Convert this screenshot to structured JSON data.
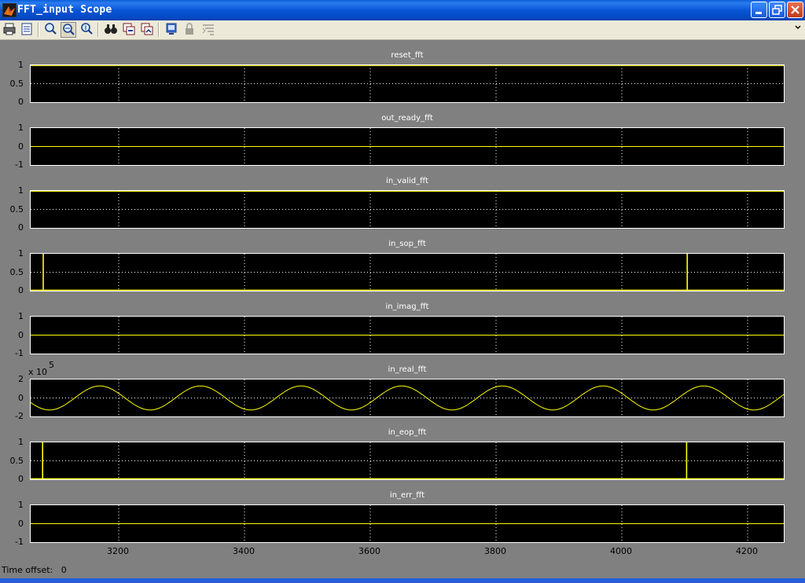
{
  "window": {
    "title": "FFT_input  Scope"
  },
  "toolbar": {
    "buttons": [
      "print-icon",
      "parameters-icon",
      "zoom-in-icon",
      "zoom-x-icon",
      "zoom-y-icon",
      "autoscale-icon",
      "save-axes-icon",
      "restore-axes-icon",
      "floating-scope-icon",
      "lock-icon",
      "signal-selection-icon"
    ]
  },
  "x_axis": {
    "ticks": [
      "3200",
      "3400",
      "3600",
      "3800",
      "4000",
      "4200"
    ],
    "range": [
      3060,
      4260
    ],
    "tick_values": [
      3200,
      3400,
      3600,
      3800,
      4000,
      4200
    ]
  },
  "time_offset": {
    "label": "Time offset:",
    "value": "0"
  },
  "chart_data": [
    {
      "type": "line",
      "title": "reset_fft",
      "y_ticks": [
        "0",
        "0.5",
        "1"
      ],
      "ylim": [
        0,
        1
      ],
      "trace": "constant",
      "value": 1,
      "grid": true
    },
    {
      "type": "line",
      "title": "out_ready_fft",
      "y_ticks": [
        "-1",
        "0",
        "1"
      ],
      "ylim": [
        -1,
        1
      ],
      "trace": "constant",
      "value": 0,
      "grid": true
    },
    {
      "type": "line",
      "title": "in_valid_fft",
      "y_ticks": [
        "0",
        "0.5",
        "1"
      ],
      "ylim": [
        0,
        1
      ],
      "trace": "constant",
      "value": 1,
      "grid": true
    },
    {
      "type": "line",
      "title": "in_sop_fft",
      "y_ticks": [
        "0",
        "0.5",
        "1"
      ],
      "ylim": [
        0,
        1
      ],
      "trace": "pulses",
      "pulses_at": [
        3080,
        4104
      ],
      "base": 0,
      "high": 1,
      "grid": true
    },
    {
      "type": "line",
      "title": "in_imag_fft",
      "y_ticks": [
        "-1",
        "0",
        "1"
      ],
      "ylim": [
        -1,
        1
      ],
      "trace": "constant",
      "value": 0,
      "grid": true
    },
    {
      "type": "line",
      "title": "in_real_fft",
      "y_ticks": [
        "-2",
        "0",
        "2"
      ],
      "ylim": [
        -2,
        2
      ],
      "exponent": "5",
      "exponent_prefix": "x 10",
      "trace": "sine",
      "amplitude": 1.3,
      "period": 160,
      "phase_x": 3130,
      "grid": true
    },
    {
      "type": "line",
      "title": "in_eop_fft",
      "y_ticks": [
        "0",
        "0.5",
        "1"
      ],
      "ylim": [
        0,
        1
      ],
      "trace": "pulses",
      "pulses_at": [
        3079,
        4103
      ],
      "base": 0,
      "high": 1,
      "grid": true
    },
    {
      "type": "line",
      "title": "in_err_fft",
      "y_ticks": [
        "-1",
        "0",
        "1"
      ],
      "ylim": [
        -1,
        1
      ],
      "trace": "constant",
      "value": 0,
      "grid": true
    }
  ],
  "colors": {
    "trace": "#ffff00",
    "axes_bg": "#000000",
    "figure_bg": "#808080",
    "grid": "#ffffff"
  }
}
